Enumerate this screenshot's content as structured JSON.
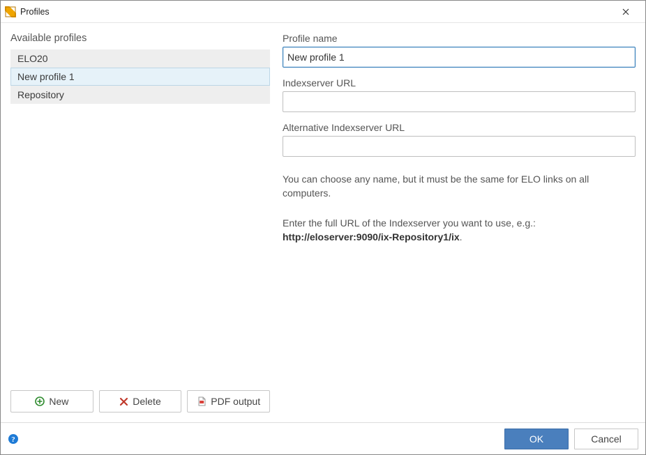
{
  "window": {
    "title": "Profiles"
  },
  "left": {
    "heading": "Available profiles",
    "items": [
      "ELO20",
      "New profile 1",
      "Repository"
    ],
    "selectedIndex": 1,
    "actions": {
      "new": "New",
      "delete": "Delete",
      "pdf": "PDF output"
    }
  },
  "form": {
    "profileNameLabel": "Profile name",
    "profileName": "New profile 1",
    "indexLabel": "Indexserver URL",
    "indexValue": "",
    "altIndexLabel": "Alternative Indexserver URL",
    "altIndexValue": "",
    "hint1": "You can choose any name, but it must be the same for ELO links on all computers.",
    "hint2a": "Enter the full URL of the Indexserver you want to use, e.g.:",
    "hint2b": "http://eloserver:9090/ix-Repository1/ix",
    "hint2c": "."
  },
  "footer": {
    "ok": "OK",
    "cancel": "Cancel"
  }
}
